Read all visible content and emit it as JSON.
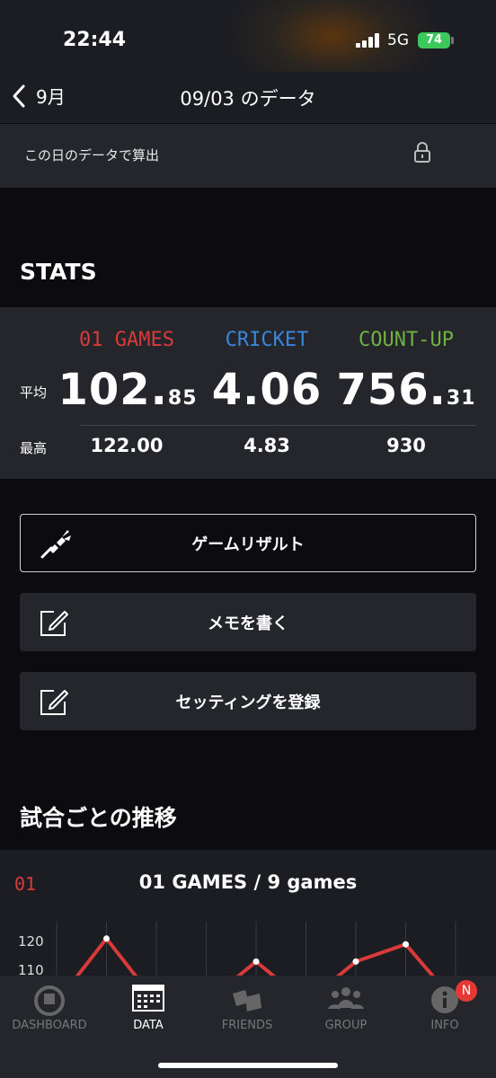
{
  "status": {
    "time": "22:44",
    "network": "5G",
    "battery": "74"
  },
  "header": {
    "back_label": "9月",
    "title": "09/03 のデータ"
  },
  "lock_row": {
    "label": "この日のデータで算出"
  },
  "stats": {
    "section_title": "STATS",
    "avg_label": "平均",
    "best_label": "最高",
    "games": [
      {
        "name": "01 GAMES",
        "color": "#d83a3a",
        "avg_int": "102.",
        "avg_dec": "85",
        "best": "122.00"
      },
      {
        "name": "CRICKET",
        "color": "#3a86d8",
        "avg_int": "4.06",
        "avg_dec": "",
        "best": "4.83"
      },
      {
        "name": "COUNT-UP",
        "color": "#6cb33f",
        "avg_int": "756.",
        "avg_dec": "31",
        "best": "930"
      }
    ]
  },
  "buttons": {
    "game_result": "ゲームリザルト",
    "write_memo": "メモを書く",
    "register_setting": "セッティングを登録"
  },
  "trend": {
    "section_title": "試合ごとの推移",
    "badge": "01",
    "chart_title": "01 GAMES / 9 games"
  },
  "chart_data": {
    "type": "line",
    "title": "01 GAMES / 9 games",
    "y_ticks": [
      "120",
      "110"
    ],
    "series": [
      {
        "values": [
          null,
          121,
          null,
          null,
          113,
          null,
          113,
          119,
          null
        ]
      }
    ],
    "color": "#d83a3a"
  },
  "tabs": [
    {
      "label": "DASHBOARD",
      "icon": "dashboard-icon"
    },
    {
      "label": "DATA",
      "icon": "data-icon"
    },
    {
      "label": "FRIENDS",
      "icon": "friends-icon"
    },
    {
      "label": "GROUP",
      "icon": "group-icon"
    },
    {
      "label": "INFO",
      "icon": "info-icon"
    }
  ],
  "info_badge": "N"
}
